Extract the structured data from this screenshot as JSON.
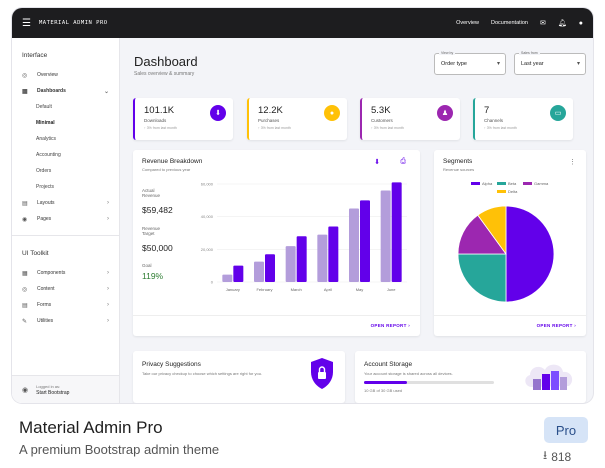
{
  "topbar": {
    "brand": "MATERIAL ADMIN PRO",
    "menu_icon": "menu-icon",
    "links": [
      "Overview",
      "Documentation"
    ],
    "icons": [
      "mail-icon",
      "bell-icon",
      "user-icon"
    ]
  },
  "sidebar": {
    "section1": "Interface",
    "items1": [
      {
        "label": "Overview",
        "icon": "circle-icon"
      },
      {
        "label": "Dashboards",
        "icon": "grid-icon"
      }
    ],
    "sub_items": [
      "Default",
      "Minimal",
      "Analytics",
      "Accounting",
      "Orders",
      "Projects"
    ],
    "items2": [
      {
        "label": "Layouts",
        "icon": "layout-icon"
      },
      {
        "label": "Pages",
        "icon": "pages-icon"
      }
    ],
    "section2": "UI Toolkit",
    "items3": [
      {
        "label": "Components",
        "icon": "components-icon"
      },
      {
        "label": "Content",
        "icon": "content-icon"
      },
      {
        "label": "Forms",
        "icon": "forms-icon"
      },
      {
        "label": "Utilities",
        "icon": "wrench-icon"
      }
    ],
    "footer": {
      "line1": "Logged in as:",
      "line2": "Start Bootstrap"
    }
  },
  "header": {
    "title": "Dashboard",
    "subtitle": "Sales overview & summary",
    "view_by": {
      "label": "View by",
      "value": "Order type"
    },
    "sales_from": {
      "label": "Sales from",
      "value": "Last year"
    }
  },
  "stats": [
    {
      "value": "101.1K",
      "label": "Downloads",
      "delta": "↑ 3%  from last month",
      "color": "#6200ea",
      "icon": "download-icon"
    },
    {
      "value": "12.2K",
      "label": "Purchases",
      "delta": "↑ 3%  from last month",
      "color": "#ffc107",
      "icon": "cart-icon"
    },
    {
      "value": "5.3K",
      "label": "Customers",
      "delta": "↑ 3%  from last month",
      "color": "#9c27b0",
      "icon": "people-icon"
    },
    {
      "value": "7",
      "label": "Channels",
      "delta": "↑ 3%  from last month",
      "color": "#26a69a",
      "icon": "devices-icon"
    }
  ],
  "revenue": {
    "title": "Revenue Breakdown",
    "subtitle": "Compared to previous year",
    "actual_label": "Actual Revenue",
    "actual_value": "$59,482",
    "target_label": "Revenue Target",
    "target_value": "$50,000",
    "goal_label": "Goal",
    "goal_value": "119%",
    "goal_color": "#2e7d32",
    "link": "OPEN REPORT  ›"
  },
  "segments": {
    "title": "Segments",
    "subtitle": "Revenue sources",
    "link": "OPEN REPORT  ›"
  },
  "privacy": {
    "title": "Privacy Suggestions",
    "text": "Take our privacy checkup to choose which settings are right for you."
  },
  "storage": {
    "title": "Account Storage",
    "text": "Your account storage is shared across all devices.",
    "usage": "10 GB of 30 GB used",
    "fraction": 0.33
  },
  "chart_data": [
    {
      "type": "bar",
      "categories": [
        "January",
        "February",
        "March",
        "April",
        "May",
        "June"
      ],
      "series": [
        {
          "values": [
            4500,
            12500,
            22000,
            29000,
            45000,
            56000
          ],
          "color": "#b39ddb"
        },
        {
          "values": [
            10000,
            17000,
            28000,
            34000,
            50000,
            61000
          ],
          "color": "#6200ea"
        }
      ],
      "ylim": [
        0,
        60000
      ],
      "yticks": [
        "0",
        "20,000",
        "40,000",
        "60,000"
      ],
      "grid": true
    },
    {
      "type": "pie",
      "labels": [
        "Alpha",
        "Beta",
        "Gamma",
        "Delta"
      ],
      "values": [
        50,
        25,
        15,
        10
      ],
      "colors": [
        "#6200ea",
        "#26a69a",
        "#9c27b0",
        "#ffc107"
      ],
      "legend": "top"
    }
  ],
  "product": {
    "name": "Material Admin Pro",
    "tagline": "A premium Bootstrap admin theme",
    "badge": "Pro",
    "downloads": "818"
  }
}
